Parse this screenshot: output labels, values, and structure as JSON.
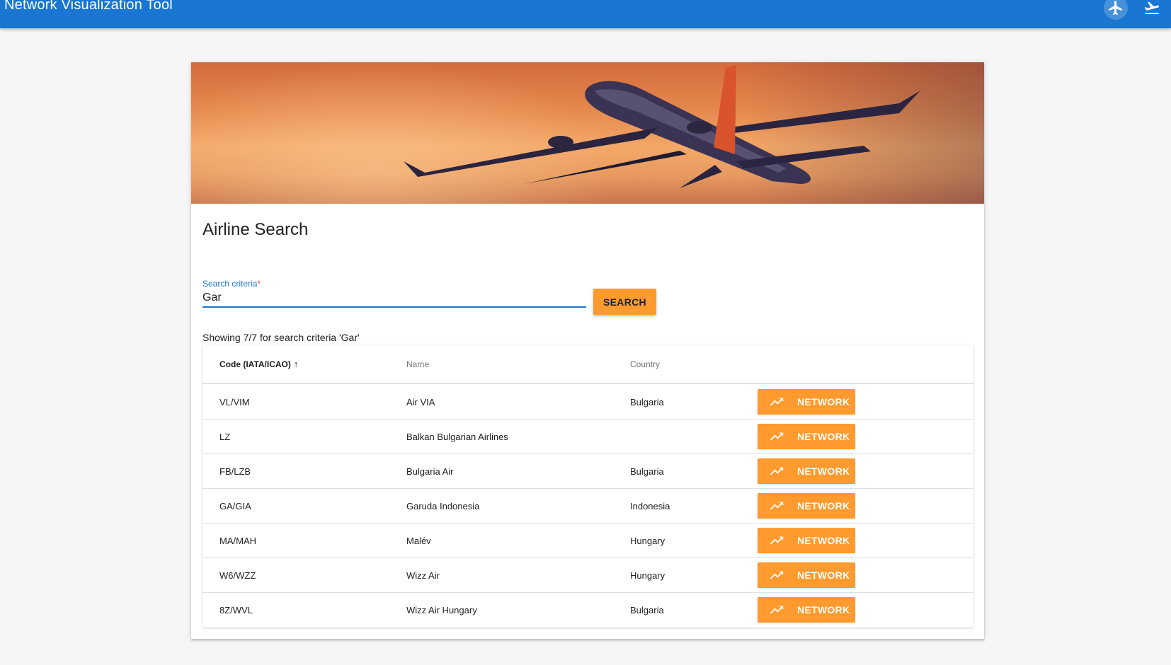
{
  "toolbar": {
    "title": "Network Visualization Tool",
    "icons": [
      "flight-icon",
      "flight-takeoff-icon"
    ],
    "color": "#1976d2"
  },
  "hero": {
    "image": "airplane-sunset-banner"
  },
  "card": {
    "title": "Airline Search"
  },
  "search": {
    "label": "Search criteria",
    "required_mark": "*",
    "value": "Gar",
    "button_label": "SEARCH"
  },
  "results": {
    "summary": "Showing 7/7 for search criteria 'Gar'"
  },
  "table": {
    "columns": {
      "code": "Code (IATA/ICAO)",
      "sort_indicator": "↑",
      "name": "Name",
      "country": "Country"
    },
    "action_label": "NETWORK",
    "action_icon": "trending-up-icon",
    "rows": [
      {
        "code": "VL/VIM",
        "name": "Air VIA",
        "country": "Bulgaria"
      },
      {
        "code": "LZ",
        "name": "Balkan Bulgarian Airlines",
        "country": ""
      },
      {
        "code": "FB/LZB",
        "name": "Bulgaria Air",
        "country": "Bulgaria"
      },
      {
        "code": "GA/GIA",
        "name": "Garuda Indonesia",
        "country": "Indonesia"
      },
      {
        "code": "MA/MAH",
        "name": "Malév",
        "country": "Hungary"
      },
      {
        "code": "W6/WZZ",
        "name": "Wizz Air",
        "country": "Hungary"
      },
      {
        "code": "8Z/WVL",
        "name": "Wizz Air Hungary",
        "country": "Bulgaria"
      }
    ]
  },
  "colors": {
    "accent": "#ff9a2e",
    "primary": "#1976d2"
  }
}
